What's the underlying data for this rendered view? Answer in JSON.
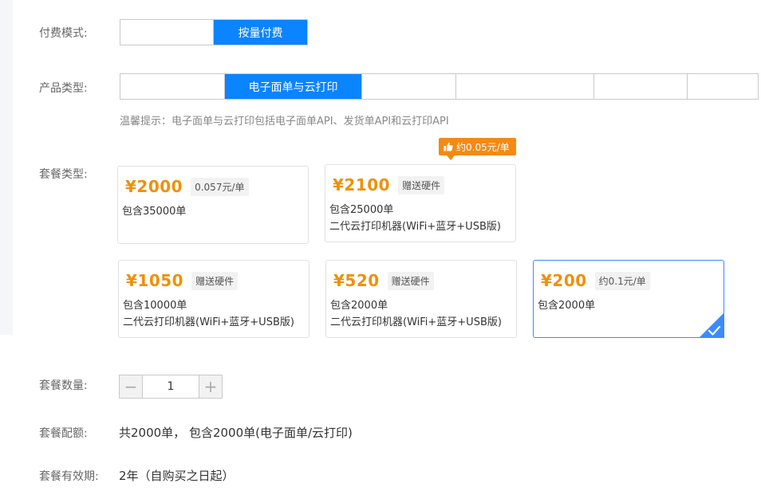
{
  "billing_mode": {
    "label": "付费模式:",
    "options": [
      "",
      "按量付费"
    ]
  },
  "product_type": {
    "label": "产品类型:",
    "options": [
      "",
      "电子面单与云打印",
      "",
      "",
      "",
      ""
    ],
    "hint": "温馨提示：电子面单与云打印包括电子面单API、发货单API和云打印API"
  },
  "package_type": {
    "label": "套餐类型:",
    "promo_bubble": "约0.05元/单",
    "cards": [
      {
        "price": "¥2000",
        "tag": "0.057元/单",
        "lines": [
          "包含35000单"
        ]
      },
      {
        "price": "¥2100",
        "tag": "赠送硬件",
        "lines": [
          "包含25000单",
          "二代云打印机器(WiFi+蓝牙+USB版)"
        ]
      },
      {
        "price": "¥1050",
        "tag": "赠送硬件",
        "lines": [
          "包含10000单",
          "二代云打印机器(WiFi+蓝牙+USB版)"
        ]
      },
      {
        "price": "¥520",
        "tag": "赠送硬件",
        "lines": [
          "包含2000单",
          "二代云打印机器(WiFi+蓝牙+USB版)"
        ]
      },
      {
        "price": "¥200",
        "tag": "约0.1元/单",
        "lines": [
          "包含2000单"
        ]
      }
    ]
  },
  "package_quantity": {
    "label": "套餐数量:",
    "value": "1",
    "minus": "−",
    "plus": "+"
  },
  "package_quota": {
    "label": "套餐配额:",
    "value": "共2000单， 包含2000单(电子面单/云打印)"
  },
  "package_validity": {
    "label": "套餐有效期:",
    "value": "2年（自购买之日起）"
  },
  "colors": {
    "primary": "#0a84ff",
    "price": "#f0900b",
    "promo": "#f48a14",
    "selected_border": "#3b8bff"
  }
}
